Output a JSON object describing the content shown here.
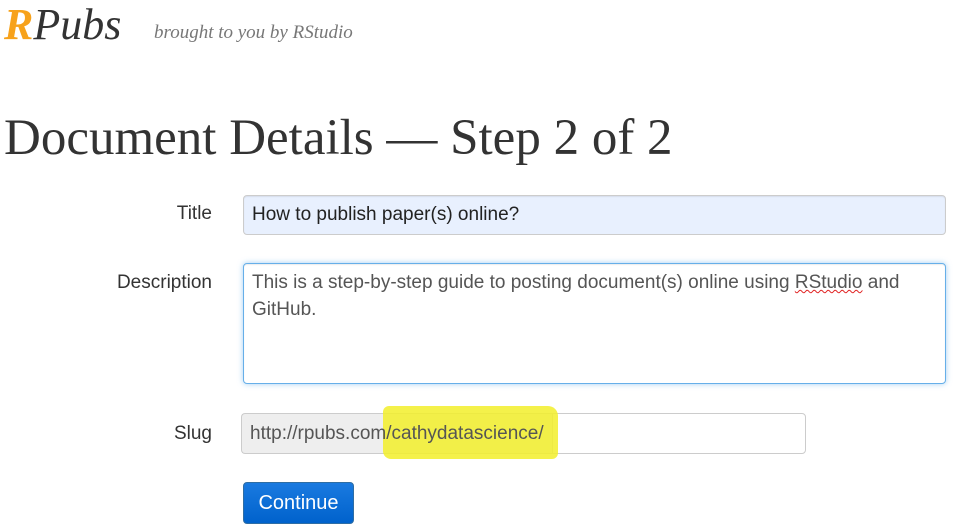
{
  "header": {
    "logo_r": "R",
    "logo_rest": "Pubs",
    "tagline": "brought to you by RStudio"
  },
  "page": {
    "title": "Document Details — Step 2 of 2"
  },
  "form": {
    "title_label": "Title",
    "title_value": "How to publish paper(s) online?",
    "description_label": "Description",
    "description_before": "This is a step-by-step guide to posting document(s) online using ",
    "description_misspelled": "RStudio",
    "description_after": " and GitHub.",
    "slug_label": "Slug",
    "slug_prefix": "http://rpubs.com/cathydatascience/",
    "slug_value": "",
    "continue_label": "Continue"
  },
  "colors": {
    "logo_accent": "#f7a21b",
    "highlight": "#f2ef2a",
    "button": "#0062cc"
  }
}
